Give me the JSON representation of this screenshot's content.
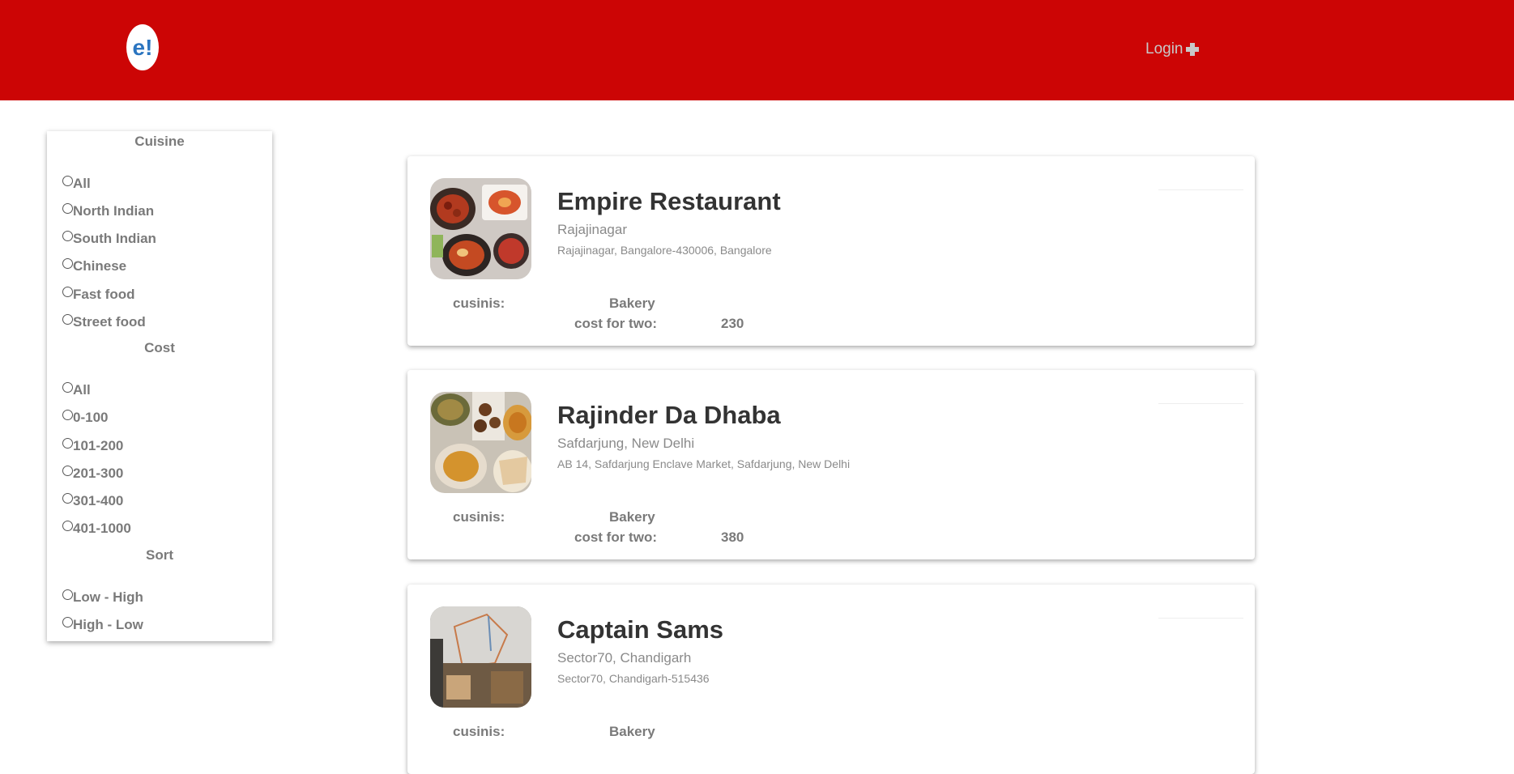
{
  "header": {
    "logo_text": "e!",
    "login_label": "Login",
    "login_icon": "plus-icon",
    "bg_color": "#cc0505"
  },
  "filters": {
    "cuisine_title": "Cuisine",
    "cuisine_options": [
      "All",
      "North Indian",
      "South Indian",
      "Chinese",
      "Fast food",
      "Street food"
    ],
    "cost_title": "Cost",
    "cost_options": [
      "All",
      "0-100",
      "101-200",
      "201-300",
      "301-400",
      "401-1000"
    ],
    "sort_title": "Sort",
    "sort_options": [
      "Low - High",
      "High - Low"
    ]
  },
  "restaurants": [
    {
      "name": "Empire Restaurant",
      "locality": "Rajajinagar",
      "address": "Rajajinagar, Bangalore-430006, Bangalore",
      "cuisine_label": "cusinis:",
      "cuisine_value": "Bakery",
      "cost_label": "cost for two:",
      "cost_value": "230"
    },
    {
      "name": "Rajinder Da Dhaba",
      "locality": "Safdarjung, New Delhi",
      "address": "AB 14, Safdarjung Enclave Market, Safdarjung, New Delhi",
      "cuisine_label": "cusinis:",
      "cuisine_value": "Bakery",
      "cost_label": "cost for two:",
      "cost_value": "380"
    },
    {
      "name": "Captain Sams",
      "locality": "Sector70, Chandigarh",
      "address": "Sector70, Chandigarh-515436",
      "cuisine_label": "cusinis:",
      "cuisine_value": "Bakery"
    }
  ]
}
